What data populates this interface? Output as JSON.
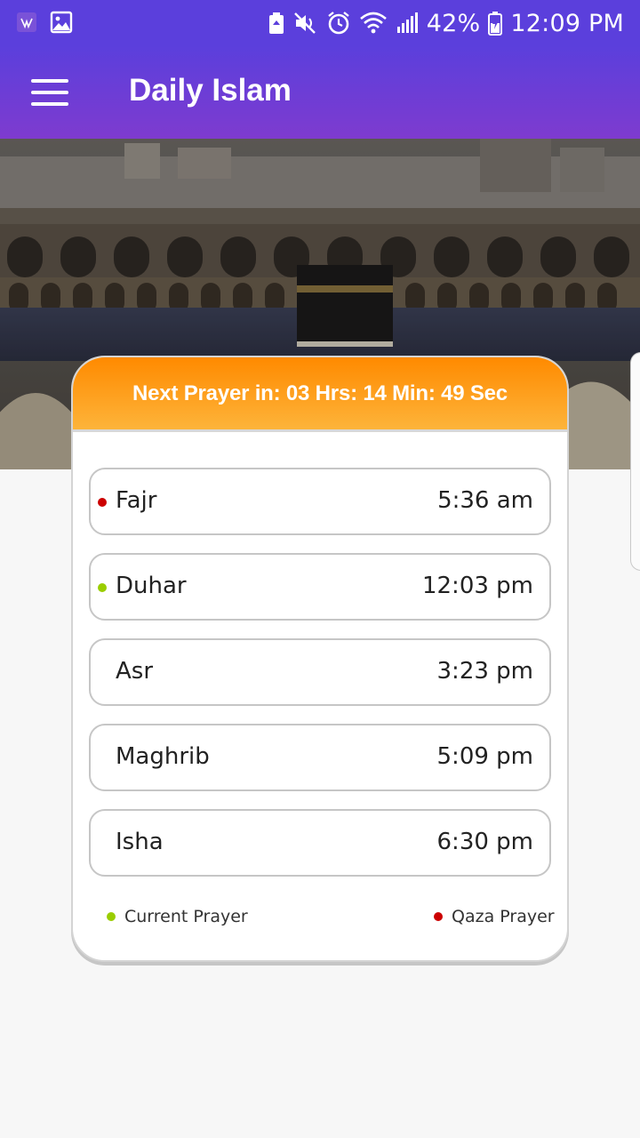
{
  "status_bar": {
    "battery": "42%",
    "time": "12:09 PM",
    "left_icons": [
      "app-notification-icon",
      "image-icon"
    ],
    "right_icons": [
      "battery-saver-icon",
      "mute-icon",
      "alarm-icon",
      "wifi-icon",
      "signal-icon",
      "battery-charging-icon"
    ]
  },
  "app_bar": {
    "title": "Daily Islam",
    "menu_icon": "hamburger-menu-icon"
  },
  "hero": {
    "image": "kaaba-photo"
  },
  "card": {
    "header": "Next Prayer in: 03 Hrs: 14 Min: 49 Sec",
    "prayers": [
      {
        "name": "Fajr",
        "time": "5:36 am",
        "status": "qaza"
      },
      {
        "name": "Duhar",
        "time": "12:03 pm",
        "status": "current"
      },
      {
        "name": "Asr",
        "time": "3:23 pm",
        "status": "none"
      },
      {
        "name": "Maghrib",
        "time": "5:09 pm",
        "status": "none"
      },
      {
        "name": "Isha",
        "time": "6:30 pm",
        "status": "none"
      }
    ],
    "legend": {
      "current_label": "Current Prayer",
      "qaza_label": "Qaza Prayer"
    }
  },
  "colors": {
    "appbar_top": "#5b3fdc",
    "appbar_bottom": "#7e3bcf",
    "header_orange": "#ff8a00",
    "current_dot": "#9acd00",
    "qaza_dot": "#cc0000"
  }
}
